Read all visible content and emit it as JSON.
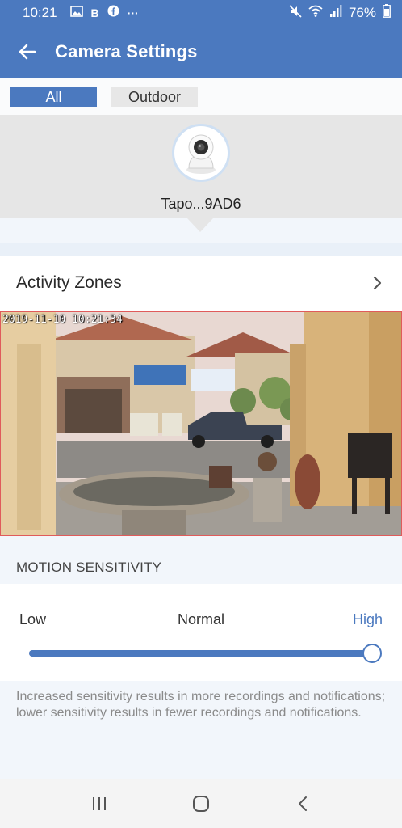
{
  "status_bar": {
    "time": "10:21",
    "battery": "76%",
    "left_icons": [
      "gallery-icon",
      "b-icon",
      "facebook-icon",
      "more-icon"
    ],
    "right_icons": [
      "mute-icon",
      "wifi-icon",
      "signal-icon",
      "battery-icon"
    ],
    "b_glyph": "B",
    "more_glyph": "···"
  },
  "app_bar": {
    "title": "Camera Settings"
  },
  "tabs": [
    {
      "label": "All",
      "selected": true
    },
    {
      "label": "Outdoor",
      "selected": false
    }
  ],
  "device": {
    "name": "Tapo...9AD6"
  },
  "activity_zones": {
    "label": "Activity Zones"
  },
  "camera": {
    "timestamp": "2019-11-10 10:21:34"
  },
  "motion_sensitivity": {
    "header": "MOTION SENSITIVITY",
    "levels": [
      "Low",
      "Normal",
      "High"
    ],
    "selected": "High",
    "value": 1.0,
    "help": "Increased sensitivity results in more recordings and notifications; lower sensitivity results in fewer recordings and notifications."
  },
  "colors": {
    "primary": "#4b79bf",
    "section_bg": "#e6e6e6",
    "page_bg": "#f2f6fb"
  }
}
